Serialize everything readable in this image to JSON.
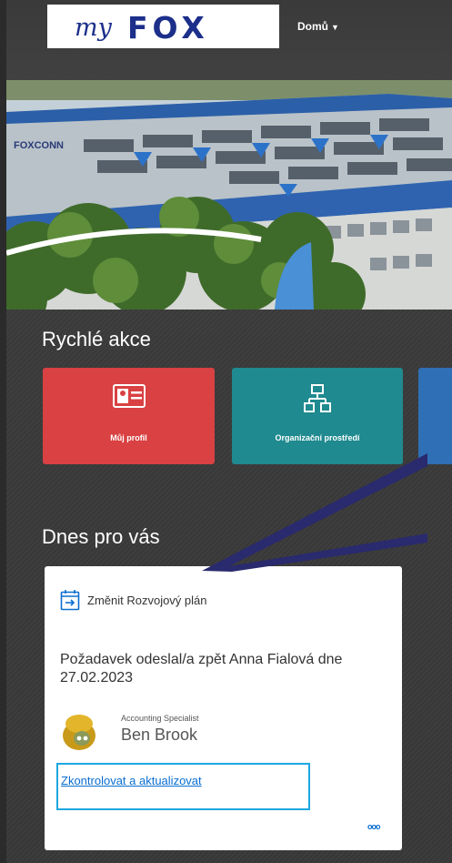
{
  "header": {
    "logo_prefix": "my",
    "logo_main": "FOX",
    "nav_home": "Domů"
  },
  "hero": {
    "building_sign": "FOXCONN"
  },
  "quick_actions": {
    "title": "Rychlé akce",
    "tiles": [
      {
        "label": "Můj profil",
        "icon": "profile-card-icon",
        "color": "#d94142"
      },
      {
        "label": "Organizační prostředí",
        "icon": "org-chart-icon",
        "color": "#1f8a8f"
      },
      {
        "label": "",
        "icon": "",
        "color": "#2f6fb5"
      }
    ]
  },
  "today": {
    "title": "Dnes pro vás",
    "card": {
      "heading": "Změnit Rozvojový plán",
      "text": "Požadavek odeslal/a zpět Anna Fialová dne 27.02.2023",
      "role": "Accounting Specialist",
      "person": "Ben Brook",
      "link": "Zkontrolovat a aktualizovat",
      "more": "ooo"
    }
  },
  "colors": {
    "brand": "#1c2f8a",
    "link": "#0a6ed1",
    "highlight_box": "#1ea7e1",
    "arrow": "#2a2a6e"
  }
}
